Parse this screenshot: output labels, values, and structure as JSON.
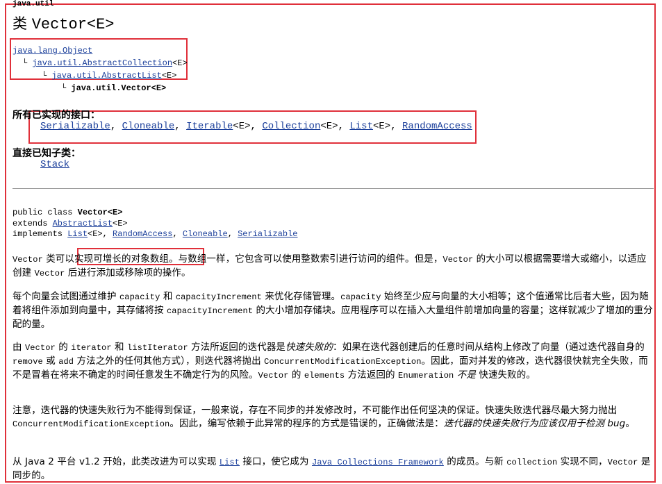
{
  "package_name": "java.util",
  "class_title": {
    "prefix": "类",
    "name": "Vector<E>"
  },
  "hierarchy": [
    {
      "text": "java.lang.Object",
      "link": true
    },
    {
      "text": "java.util.AbstractCollection",
      "suffix": "<E>",
      "link": true
    },
    {
      "text": "java.util.AbstractList",
      "suffix": "<E>",
      "link": true
    },
    {
      "text": "java.util.Vector<E>",
      "link": false
    }
  ],
  "interfaces": {
    "label": "所有已实现的接口：",
    "items": [
      {
        "name": "Serializable",
        "generic": ""
      },
      {
        "name": "Cloneable",
        "generic": ""
      },
      {
        "name": "Iterable",
        "generic": "<E>"
      },
      {
        "name": "Collection",
        "generic": "<E>"
      },
      {
        "name": "List",
        "generic": "<E>"
      },
      {
        "name": "RandomAccess",
        "generic": ""
      }
    ]
  },
  "subclasses": {
    "label": "直接已知子类：",
    "items": [
      "Stack"
    ]
  },
  "signature": {
    "line1_prefix": "public class ",
    "line1_name": "Vector<E>",
    "line2_prefix": "extends ",
    "line2_link": "AbstractList",
    "line2_suffix": "<E>",
    "line3_prefix": "implements ",
    "line3_items": [
      {
        "name": "List",
        "generic": "<E>"
      },
      {
        "name": "RandomAccess",
        "generic": ""
      },
      {
        "name": "Cloneable",
        "generic": ""
      },
      {
        "name": "Serializable",
        "generic": ""
      }
    ]
  },
  "paragraphs": {
    "p1": {
      "t0": "Vector",
      "t1": " 类可以",
      "highlight": "实现可增长的对象数组。",
      "t2": "与数组一样，它包含可以使用整数索引进行访问的组件。但是，",
      "t3": "Vector",
      "t4": " 的大小可以根据需要增大或缩小，以适应创建 ",
      "t5": "Vector",
      "t6": " 后进行添加或移除项的操作。"
    },
    "p2": {
      "t0": "每个向量会试图通过维护 ",
      "t1": "capacity",
      "t2": " 和 ",
      "t3": "capacityIncrement",
      "t4": " 来优化存储管理。",
      "t5": "capacity",
      "t6": " 始终至少应与向量的大小相等；这个值通常比后者大些，因为随着将组件添加到向量中，其存储将按 ",
      "t7": "capacityIncrement",
      "t8": " 的大小增加存储块。应用程序可以在插入大量组件前增加向量的容量；这样就减少了增加的重分配的量。"
    },
    "p3": {
      "t0": "由 ",
      "t1": "Vector",
      "t2": " 的 ",
      "t3": "iterator",
      "t4": " 和 ",
      "t5": "listIterator",
      "t6": " 方法所返回的迭代器是",
      "t7": "快速失败的",
      "t8": "：如果在迭代器创建后的任意时间从结构上修改了向量（通过迭代器自身的 ",
      "t9": "remove",
      "t10": " 或 ",
      "t11": "add",
      "t12": " 方法之外的任何其他方式），则迭代器将抛出 ",
      "t13": "ConcurrentModificationException",
      "t14": "。因此，面对并发的修改，迭代器很快就完全失败，而不是冒着在将来不确定的时间任意发生不确定行为的风险。",
      "t15": "Vector",
      "t16": " 的 ",
      "t17": "elements",
      "t18": " 方法返回的 ",
      "t19": "Enumeration",
      "t20": " ",
      "t21": "不是",
      "t22": " 快速失败的。"
    },
    "p4": {
      "t0": "注意，迭代器的快速失败行为不能得到保证，一般来说，存在不同步的并发修改时，不可能作出任何坚决的保证。快速失败迭代器尽最大努力抛出 ",
      "t1": "ConcurrentModificationException",
      "t2": "。因此，编写依赖于此异常的程序的方式是错误的，正确做法是：",
      "t3": "迭代器的快速失败行为应该仅用于检测 bug",
      "t4": "。"
    },
    "p5": {
      "t0": "从 Java 2 平台 v1.2 开始，此类改进为可以实现 ",
      "link1": "List",
      "t1": " 接口，使它成为 ",
      "link2": "Java Collections Framework",
      "t2": " 的成员。与新 ",
      "t3": "collection",
      "t4": " 实现不同，",
      "t5": "Vector",
      "t6": " 是同步的。"
    }
  },
  "colors": {
    "link": "#1a3e9a",
    "highlight_box": "#e0303a",
    "rule": "#9a9a9a"
  }
}
